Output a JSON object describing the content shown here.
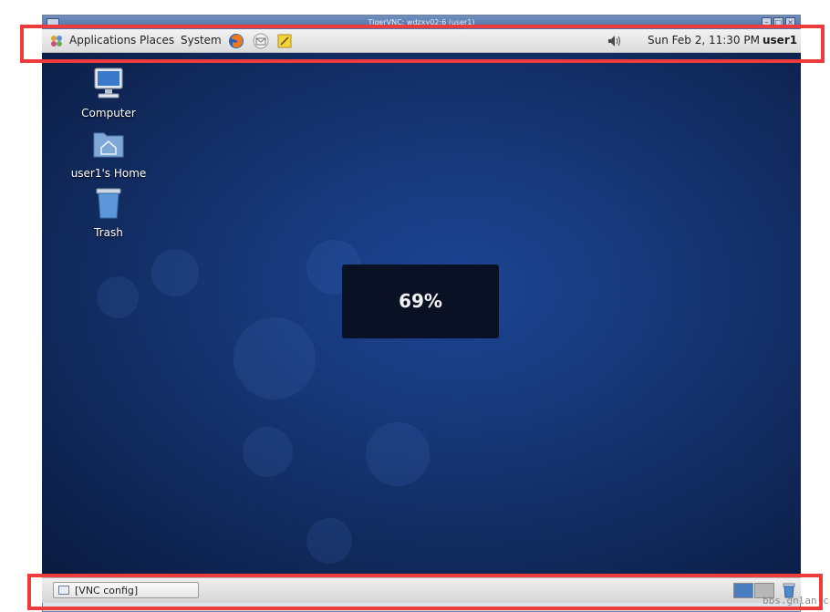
{
  "window": {
    "title": "TigerVNC: wdzxy02:6 (user1)"
  },
  "top_panel": {
    "menus": [
      {
        "label": "Applications"
      },
      {
        "label": "Places"
      },
      {
        "label": "System"
      }
    ],
    "launchers": [
      "firefox-icon",
      "mail-icon",
      "notes-icon"
    ],
    "clock": "Sun Feb  2, 11:30 PM",
    "user": "user1"
  },
  "desktop": {
    "icons": [
      {
        "label": "Computer",
        "icon": "computer-icon"
      },
      {
        "label": "user1's Home",
        "icon": "home-folder-icon"
      },
      {
        "label": "Trash",
        "icon": "trash-icon"
      }
    ],
    "progress": {
      "text": "69%",
      "value": 69
    }
  },
  "bottom_panel": {
    "task": "[VNC config]"
  },
  "watermark": "bbs.gnlan.cn",
  "colors": {
    "desktop": "#15336f",
    "annotation": "#ee3b3b",
    "progress_box": "#0b1125"
  }
}
